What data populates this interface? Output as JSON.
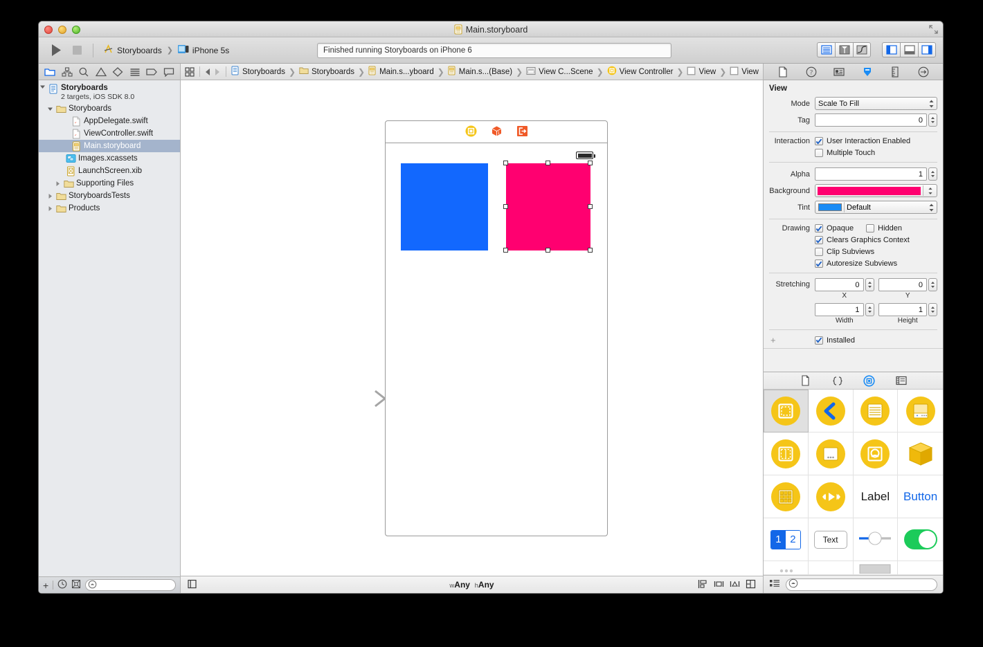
{
  "window": {
    "title": "Main.storyboard",
    "title_icon": "storyboard-file-icon"
  },
  "toolbar": {
    "run_label": "Run",
    "stop_label": "Stop",
    "scheme_project": "Storyboards",
    "scheme_device": "iPhone 5s",
    "status_message": "Finished running Storyboards on iPhone 6",
    "editor_modes": [
      "standard-editor-icon",
      "assistant-editor-icon",
      "version-editor-icon"
    ],
    "panel_toggles": [
      "navigator-toggle-icon",
      "debug-toggle-icon",
      "utilities-toggle-icon"
    ]
  },
  "navigator": {
    "tabs": [
      "project-navigator-icon",
      "symbol-navigator-icon",
      "search-navigator-icon",
      "issue-navigator-icon",
      "test-navigator-icon",
      "debug-navigator-icon",
      "breakpoint-navigator-icon",
      "report-navigator-icon"
    ],
    "tree": [
      {
        "label": "Storyboards",
        "sublabel": "2 targets, iOS SDK 8.0",
        "icon": "project-icon",
        "depth": 0,
        "twisty": "down",
        "selected": false,
        "kind": "project"
      },
      {
        "label": "Storyboards",
        "icon": "folder-icon",
        "depth": 1,
        "twisty": "down",
        "selected": false,
        "kind": "group"
      },
      {
        "label": "AppDelegate.swift",
        "icon": "swift-file-icon",
        "depth": 2,
        "twisty": "none",
        "selected": false,
        "kind": "file"
      },
      {
        "label": "ViewController.swift",
        "icon": "swift-file-icon",
        "depth": 2,
        "twisty": "none",
        "selected": false,
        "kind": "file"
      },
      {
        "label": "Main.storyboard",
        "icon": "storyboard-file-icon",
        "depth": 2,
        "twisty": "none",
        "selected": true,
        "kind": "file"
      },
      {
        "label": "Images.xcassets",
        "icon": "assets-icon",
        "depth": 2,
        "twisty": "none",
        "selected": false,
        "kind": "file"
      },
      {
        "label": "LaunchScreen.xib",
        "icon": "xib-file-icon",
        "depth": 2,
        "twisty": "none",
        "selected": false,
        "kind": "file"
      },
      {
        "label": "Supporting Files",
        "icon": "folder-icon",
        "depth": 2,
        "twisty": "right",
        "selected": false,
        "kind": "group"
      },
      {
        "label": "StoryboardsTests",
        "icon": "folder-icon",
        "depth": 1,
        "twisty": "right",
        "selected": false,
        "kind": "group"
      },
      {
        "label": "Products",
        "icon": "folder-icon",
        "depth": 1,
        "twisty": "right",
        "selected": false,
        "kind": "group"
      }
    ],
    "bottom": {
      "add_label": "+",
      "recent_icon": "clock-icon",
      "filter_icon": "source-control-icon",
      "search_placeholder": ""
    }
  },
  "jumpbar": {
    "related_icon": "related-items-icon",
    "back_label": "Back",
    "forward_label": "Forward",
    "breadcrumbs": [
      {
        "label": "Storyboards",
        "icon": "project-icon"
      },
      {
        "label": "Storyboards",
        "icon": "folder-icon"
      },
      {
        "label": "Main.s...yboard",
        "icon": "storyboard-file-icon"
      },
      {
        "label": "Main.s...(Base)",
        "icon": "storyboard-file-icon"
      },
      {
        "label": "View C...Scene",
        "icon": "scene-icon"
      },
      {
        "label": "View Controller",
        "icon": "view-controller-icon"
      },
      {
        "label": "View",
        "icon": "view-icon"
      },
      {
        "label": "View",
        "icon": "view-icon"
      }
    ]
  },
  "canvas": {
    "scene_dock": [
      "view-controller-icon",
      "first-responder-icon",
      "exit-icon"
    ],
    "blue_view_color": "#1268fe",
    "pink_view_color": "#ff0070",
    "selected_view": "pink-square",
    "size_class_w": "Any",
    "size_class_h": "Any",
    "size_class_w_prefix": "w",
    "size_class_h_prefix": "h",
    "bottom_tools": [
      "hide-panel-icon",
      "align-icon",
      "pin-icon",
      "resolve-issues-icon",
      "resizing-icon"
    ]
  },
  "inspector": {
    "tabs": [
      "file-inspector-icon",
      "quick-help-icon",
      "identity-inspector-icon",
      "attributes-inspector-icon",
      "size-inspector-icon",
      "connections-inspector-icon"
    ],
    "selected_tab": "attributes-inspector-icon",
    "section_title": "View",
    "fields": {
      "mode_label": "Mode",
      "mode_value": "Scale To Fill",
      "tag_label": "Tag",
      "tag_value": "0",
      "interaction_label": "Interaction",
      "user_interaction_enabled_label": "User Interaction Enabled",
      "user_interaction_enabled_checked": true,
      "multiple_touch_label": "Multiple Touch",
      "multiple_touch_checked": false,
      "alpha_label": "Alpha",
      "alpha_value": "1",
      "background_label": "Background",
      "background_color": "#ff0070",
      "tint_label": "Tint",
      "tint_value": "Default",
      "tint_color": "#1a8cf5",
      "drawing_label": "Drawing",
      "opaque_label": "Opaque",
      "opaque_checked": true,
      "hidden_label": "Hidden",
      "hidden_checked": false,
      "clears_graphics_label": "Clears Graphics Context",
      "clears_graphics_checked": true,
      "clip_subviews_label": "Clip Subviews",
      "clip_subviews_checked": false,
      "autoresize_label": "Autoresize Subviews",
      "autoresize_checked": true,
      "stretching_label": "Stretching",
      "stretch_x_value": "0",
      "stretch_x_caption": "X",
      "stretch_y_value": "0",
      "stretch_y_caption": "Y",
      "stretch_w_value": "1",
      "stretch_w_caption": "Width",
      "stretch_h_value": "1",
      "stretch_h_caption": "Height",
      "installed_label": "Installed",
      "installed_checked": true,
      "add_variation_label": "+"
    }
  },
  "library": {
    "tabs": [
      "file-template-library-icon",
      "code-snippet-library-icon",
      "object-library-icon",
      "media-library-icon"
    ],
    "selected_tab": "object-library-icon",
    "items": [
      {
        "name": "view-controller-object",
        "icon": "view-controller-object-icon",
        "selected": true
      },
      {
        "name": "navigation-controller-object",
        "icon": "back-chevron-icon",
        "selected": false
      },
      {
        "name": "table-view-controller-object",
        "icon": "table-lines-icon",
        "selected": false
      },
      {
        "name": "tab-bar-controller-object",
        "icon": "tab-bar-icon",
        "selected": false
      },
      {
        "name": "split-view-controller-object",
        "icon": "split-view-icon",
        "selected": false
      },
      {
        "name": "page-view-controller-object",
        "icon": "page-dots-icon",
        "selected": false
      },
      {
        "name": "gl-kit-view-controller-object",
        "icon": "glkit-icon",
        "selected": false
      },
      {
        "name": "object-cube",
        "icon": "cube-icon",
        "selected": false
      },
      {
        "name": "collection-view-controller-object",
        "icon": "grid-icon",
        "selected": false
      },
      {
        "name": "av-player-view-controller-object",
        "icon": "playback-icon",
        "selected": false
      },
      {
        "name": "label-object",
        "icon": "label-text-icon",
        "label": "Label",
        "selected": false
      },
      {
        "name": "button-object",
        "icon": "button-text-icon",
        "label": "Button",
        "selected": false
      },
      {
        "name": "segmented-control-object",
        "icon": "segmented-control-icon",
        "seg_a": "1",
        "seg_b": "2",
        "selected": false
      },
      {
        "name": "text-field-object",
        "icon": "text-field-icon",
        "label": "Text",
        "selected": false
      },
      {
        "name": "slider-object",
        "icon": "slider-icon",
        "selected": false
      },
      {
        "name": "switch-object",
        "icon": "switch-icon",
        "selected": false
      }
    ],
    "bottom": {
      "list_view_icon": "list-view-icon",
      "search_icon": "search-icon",
      "search_placeholder": ""
    }
  }
}
